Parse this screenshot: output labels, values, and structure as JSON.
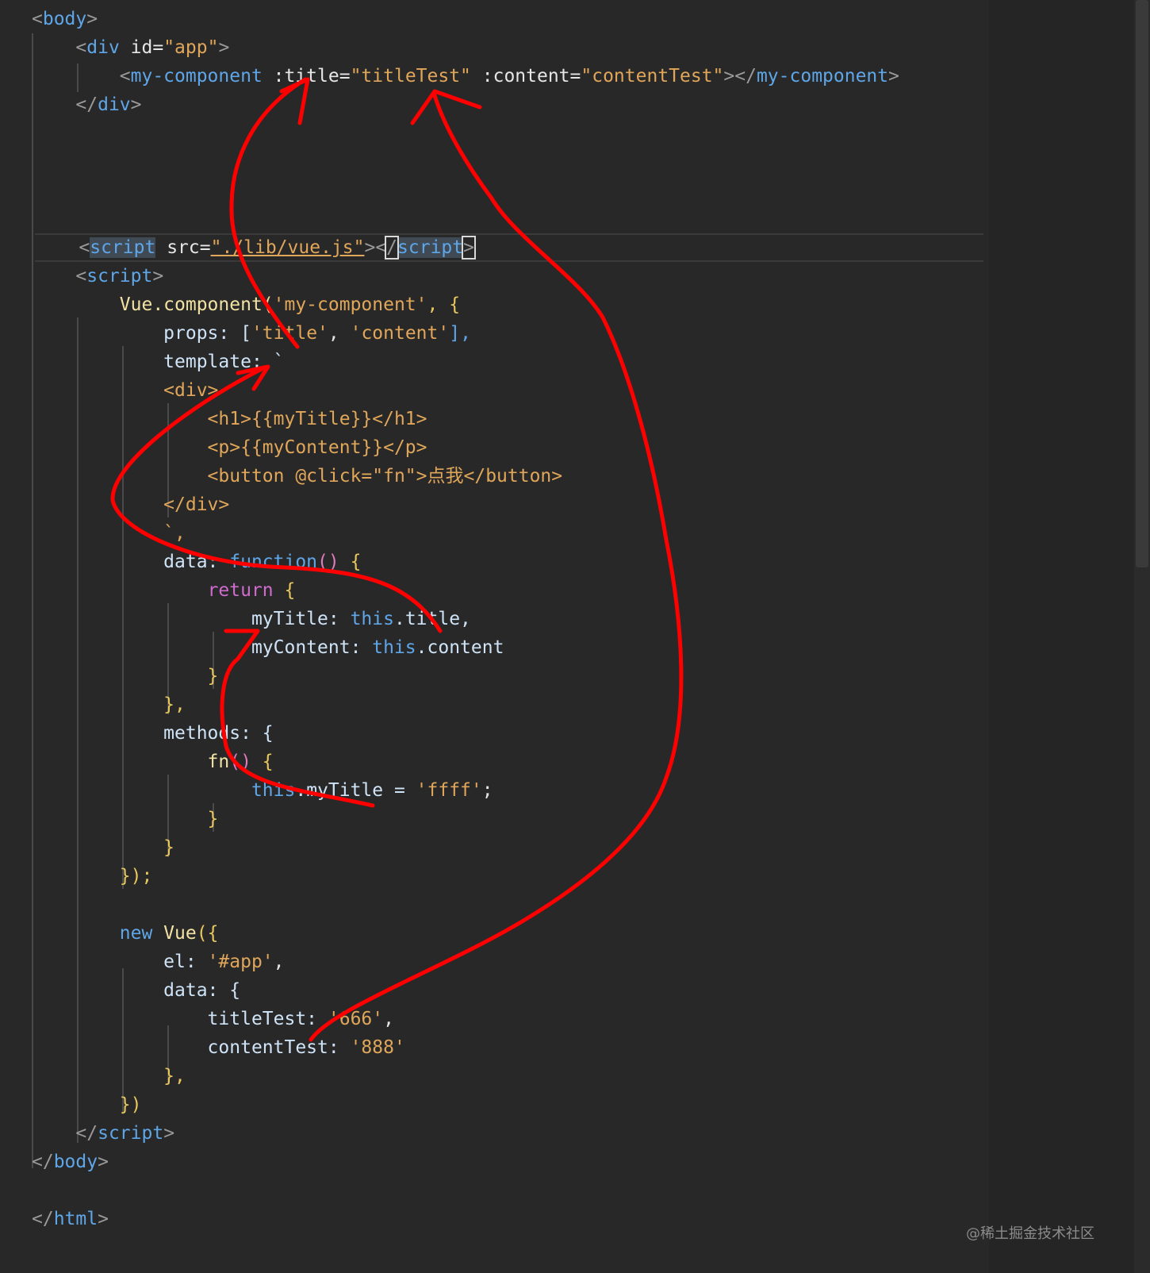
{
  "lines": [
    [
      "<",
      "body",
      ">"
    ],
    [
      "    <",
      "div",
      " id=",
      "\"app\"",
      ">"
    ],
    [
      "        <",
      "my-component",
      " :title=",
      "\"titleTest\"",
      " :content=",
      "\"contentTest\"",
      "></",
      "my-component",
      ">"
    ],
    [
      "    </",
      "div",
      ">"
    ],
    [],
    [],
    [],
    [],
    [
      "    <",
      "script",
      " src=",
      "\"./lib/vue.js\"",
      "><",
      "/",
      "script",
      ">"
    ],
    [
      "    <",
      "script",
      ">"
    ],
    [
      "        Vue.component(",
      "'my-component'",
      ", {"
    ],
    [
      "            props: [",
      "'title'",
      ", ",
      "'content'",
      "],"
    ],
    [
      "            template: `"
    ],
    [
      "            <div>"
    ],
    [
      "                <h1>{{myTitle}}</h1>"
    ],
    [
      "                <p>{{myContent}}</p>"
    ],
    [
      "                <button @click=\"fn\">点我</button>"
    ],
    [
      "            </div>"
    ],
    [
      "            `,"
    ],
    [
      "            data: ",
      "function",
      "()",
      " {"
    ],
    [
      "                ",
      "return",
      " {"
    ],
    [
      "                    myTitle: ",
      "this",
      ".title,"
    ],
    [
      "                    myContent: ",
      "this",
      ".content"
    ],
    [
      "                }"
    ],
    [
      "            },"
    ],
    [
      "            methods: {"
    ],
    [
      "                fn",
      "()",
      " {"
    ],
    [
      "                    ",
      "this",
      ".myTitle = ",
      "'ffff'",
      ";"
    ],
    [
      "                }"
    ],
    [
      "            }"
    ],
    [
      "        });"
    ],
    [],
    [
      "        ",
      "new",
      " Vue",
      "({"
    ],
    [
      "            el: ",
      "'#app'",
      ","
    ],
    [
      "            data: {"
    ],
    [
      "                titleTest: ",
      "'666'",
      ","
    ],
    [
      "                contentTest: ",
      "'888'"
    ],
    [
      "            },"
    ],
    [
      "        })"
    ],
    [
      "    </",
      "script",
      ">"
    ],
    [
      "</",
      "body",
      ">"
    ],
    [],
    [
      "</",
      "html",
      ">"
    ]
  ],
  "watermark": "@稀土掘金技术社区",
  "colors": {
    "background": "#282828",
    "tag": "#5fa6e8",
    "string": "#e0a65a",
    "annotation": "#ff0000"
  }
}
